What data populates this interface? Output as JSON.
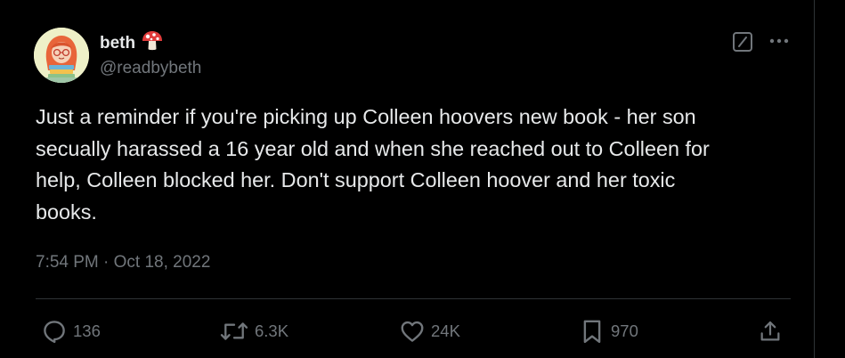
{
  "author": {
    "name": "beth",
    "handle": "@readbybeth",
    "name_emoji_icon": "mushroom-icon"
  },
  "tweet": {
    "text": "Just a reminder if you're picking up Colleen hoovers new book - her son\nsecually harassed a 16 year old and when she reached out to Colleen for\nhelp, Colleen blocked her. Don't support Colleen hoover and her toxic\nbooks.",
    "timestamp": "7:54 PM · Oct 18, 2022"
  },
  "actions": {
    "replies": "136",
    "reposts": "6.3K",
    "likes": "24K",
    "bookmarks": "970"
  },
  "icons": {
    "grok": "grok-icon",
    "more": "more-options-icon",
    "reply": "reply-icon",
    "repost": "repost-icon",
    "like": "heart-icon",
    "bookmark": "bookmark-icon",
    "share": "share-icon"
  },
  "colors": {
    "background": "#000000",
    "text_primary": "#e7e9ea",
    "text_secondary": "#71767b",
    "divider": "#2f3336"
  }
}
